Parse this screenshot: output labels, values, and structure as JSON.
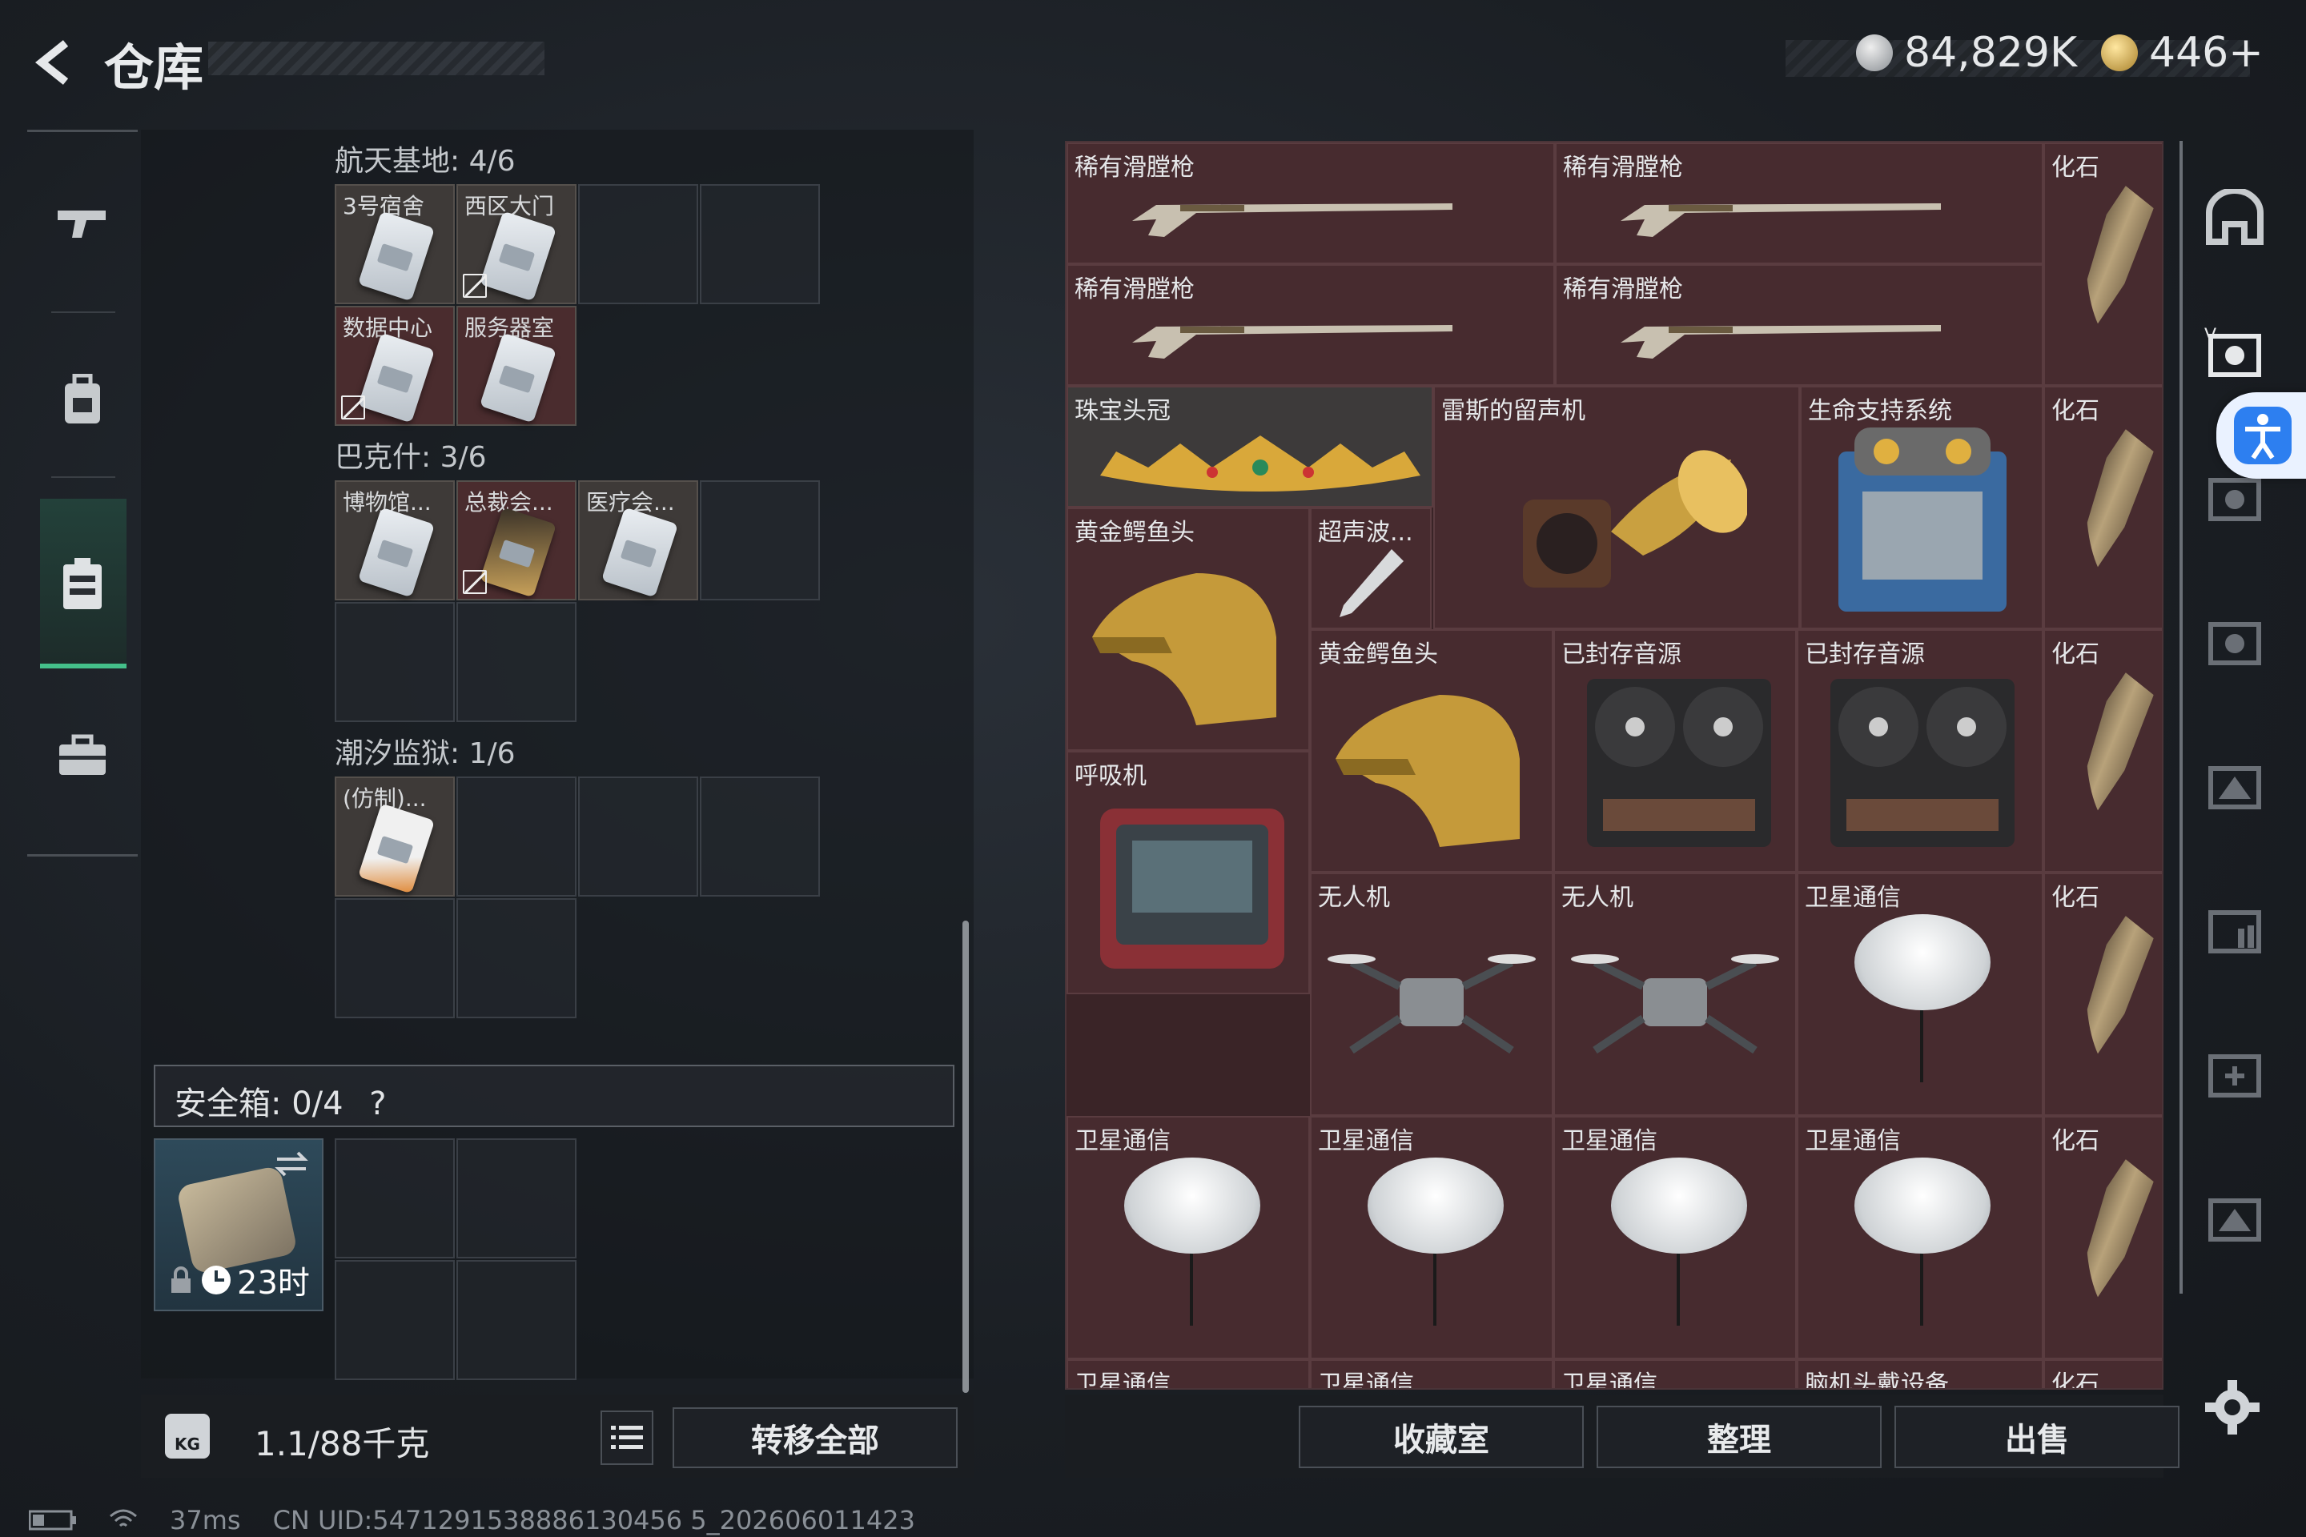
{
  "header": {
    "title": "仓库",
    "back_icon": "back-arrow-icon",
    "currency_coins": "84,829K",
    "currency_premium": "446+",
    "coin_color": "#b8b8b8",
    "premium_color": "#d8b04a"
  },
  "left_nav": [
    {
      "icon": "gun-icon"
    },
    {
      "icon": "backpack-icon"
    },
    {
      "icon": "keycard-case-icon"
    },
    {
      "icon": "briefcase-icon"
    }
  ],
  "keycard_groups": [
    {
      "title": "航天基地: 4/6",
      "cards": [
        {
          "label": "3号宿舍"
        },
        {
          "label": "西区大门"
        },
        {
          "label": "数据中心"
        },
        {
          "label": "服务器室"
        }
      ]
    },
    {
      "title": "巴克什: 3/6",
      "cards": [
        {
          "label": "博物馆..."
        },
        {
          "label": "总裁会..."
        },
        {
          "label": "医疗会..."
        }
      ]
    },
    {
      "title": "潮汐监狱: 1/6",
      "cards": [
        {
          "label": "(仿制)..."
        }
      ]
    }
  ],
  "safe_box": {
    "label": "安全箱: 0/4",
    "help": "?",
    "timer": "23时"
  },
  "weight": "1.1/88千克",
  "weight_icon": "KG",
  "transfer_all": "转移全部",
  "stash_items": {
    "r1c1": "稀有滑膛枪",
    "r1c2": "稀有滑膛枪",
    "r2c1": "稀有滑膛枪",
    "r2c2": "稀有滑膛枪",
    "fossil": "化石",
    "crown": "珠宝头冠",
    "gramophone": "雷斯的留声机",
    "lifesupport": "生命支持系统",
    "croc1": "黄金鳄鱼头",
    "ultrasonic": "超声波...",
    "croc2": "黄金鳄鱼头",
    "tape1": "已封存音源",
    "tape2": "已封存音源",
    "ventilator": "呼吸机",
    "drone1": "无人机",
    "drone2": "无人机",
    "sat": "卫星通信",
    "helmet": "脑机头戴设备"
  },
  "bottom_buttons": {
    "collection": "收藏室",
    "sort": "整理",
    "sell": "出售"
  },
  "status": {
    "ping": "37ms",
    "uid": "CN UID:5471291538886130456 5_202606011423"
  }
}
